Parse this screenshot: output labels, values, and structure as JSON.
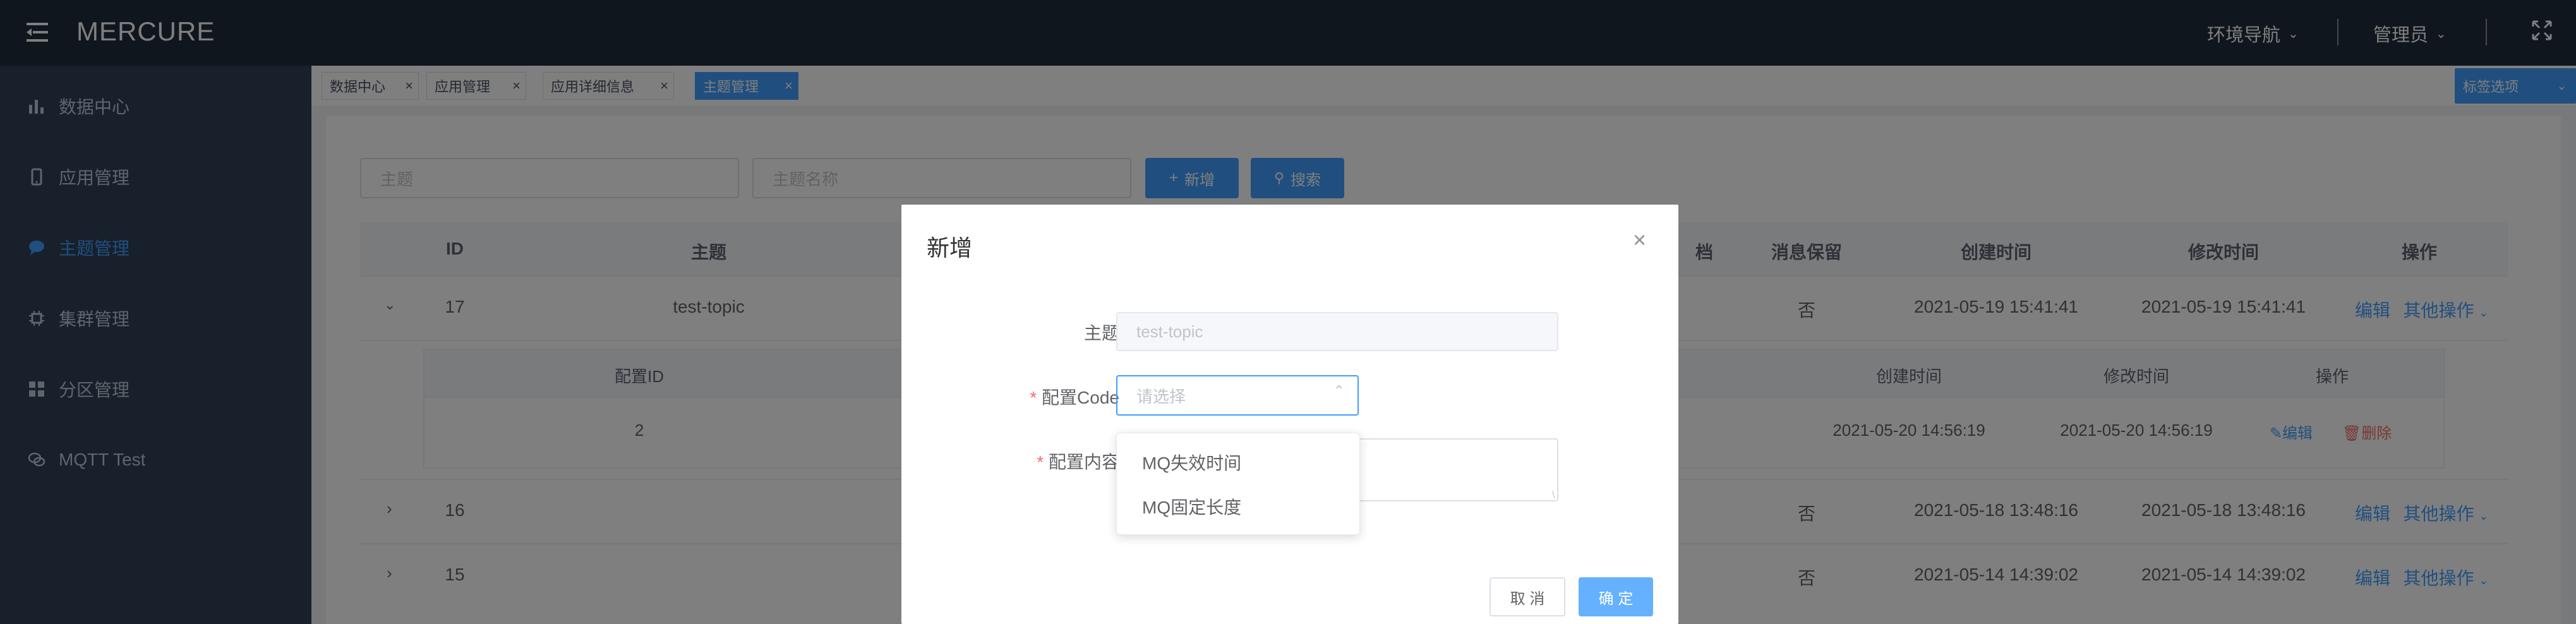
{
  "header": {
    "logo": "MERCURE",
    "env_nav": "环境导航",
    "user": "管理员"
  },
  "sidebar": {
    "items": [
      {
        "label": "数据中心",
        "icon": "bar-chart-icon",
        "active": false
      },
      {
        "label": "应用管理",
        "icon": "mobile-icon",
        "active": false
      },
      {
        "label": "主题管理",
        "icon": "chat-icon",
        "active": true
      },
      {
        "label": "集群管理",
        "icon": "chip-icon",
        "active": false
      },
      {
        "label": "分区管理",
        "icon": "grid-icon",
        "active": false
      },
      {
        "label": "MQTT Test",
        "icon": "chat-bubbles-icon",
        "active": false
      }
    ]
  },
  "tags": {
    "items": [
      {
        "label": "数据中心",
        "active": false
      },
      {
        "label": "应用管理",
        "active": false
      },
      {
        "label": "应用详细信息",
        "active": false
      },
      {
        "label": "主题管理",
        "active": true
      }
    ],
    "options_label": "标签选项"
  },
  "search": {
    "topic_placeholder": "主题",
    "name_placeholder": "主题名称",
    "add_label": "新增",
    "search_label": "搜索"
  },
  "table": {
    "headers": [
      "ID",
      "主题",
      "档",
      "消息保留",
      "创建时间",
      "修改时间",
      "操作"
    ],
    "rows": [
      {
        "id": "17",
        "topic": "test-topic",
        "retain": "否",
        "created": "2021-05-19 15:41:41",
        "modified": "2021-05-19 15:41:41",
        "edit": "编辑",
        "more": "其他操作"
      },
      {
        "id": "16",
        "topic": "",
        "retain": "否",
        "created": "2021-05-18 13:48:16",
        "modified": "2021-05-18 13:48:16",
        "edit": "编辑",
        "more": "其他操作"
      },
      {
        "id": "15",
        "topic": "",
        "retain": "否",
        "created": "2021-05-14 14:39:02",
        "modified": "2021-05-14 14:39:02",
        "edit": "编辑",
        "more": "其他操作"
      }
    ],
    "sub": {
      "headers": [
        "配置ID",
        "创建时间",
        "修改时间",
        "操作"
      ],
      "row": {
        "id": "2",
        "created": "2021-05-20 14:56:19",
        "modified": "2021-05-20 14:56:19",
        "edit": "编辑",
        "delete": "删除"
      }
    }
  },
  "dialog": {
    "title": "新增",
    "topic_label": "主题",
    "topic_value": "test-topic",
    "code_label": "配置Code",
    "code_placeholder": "请选择",
    "content_label": "配置内容",
    "cancel": "取 消",
    "confirm": "确 定",
    "options": [
      "MQ失效时间",
      "MQ固定长度"
    ]
  }
}
